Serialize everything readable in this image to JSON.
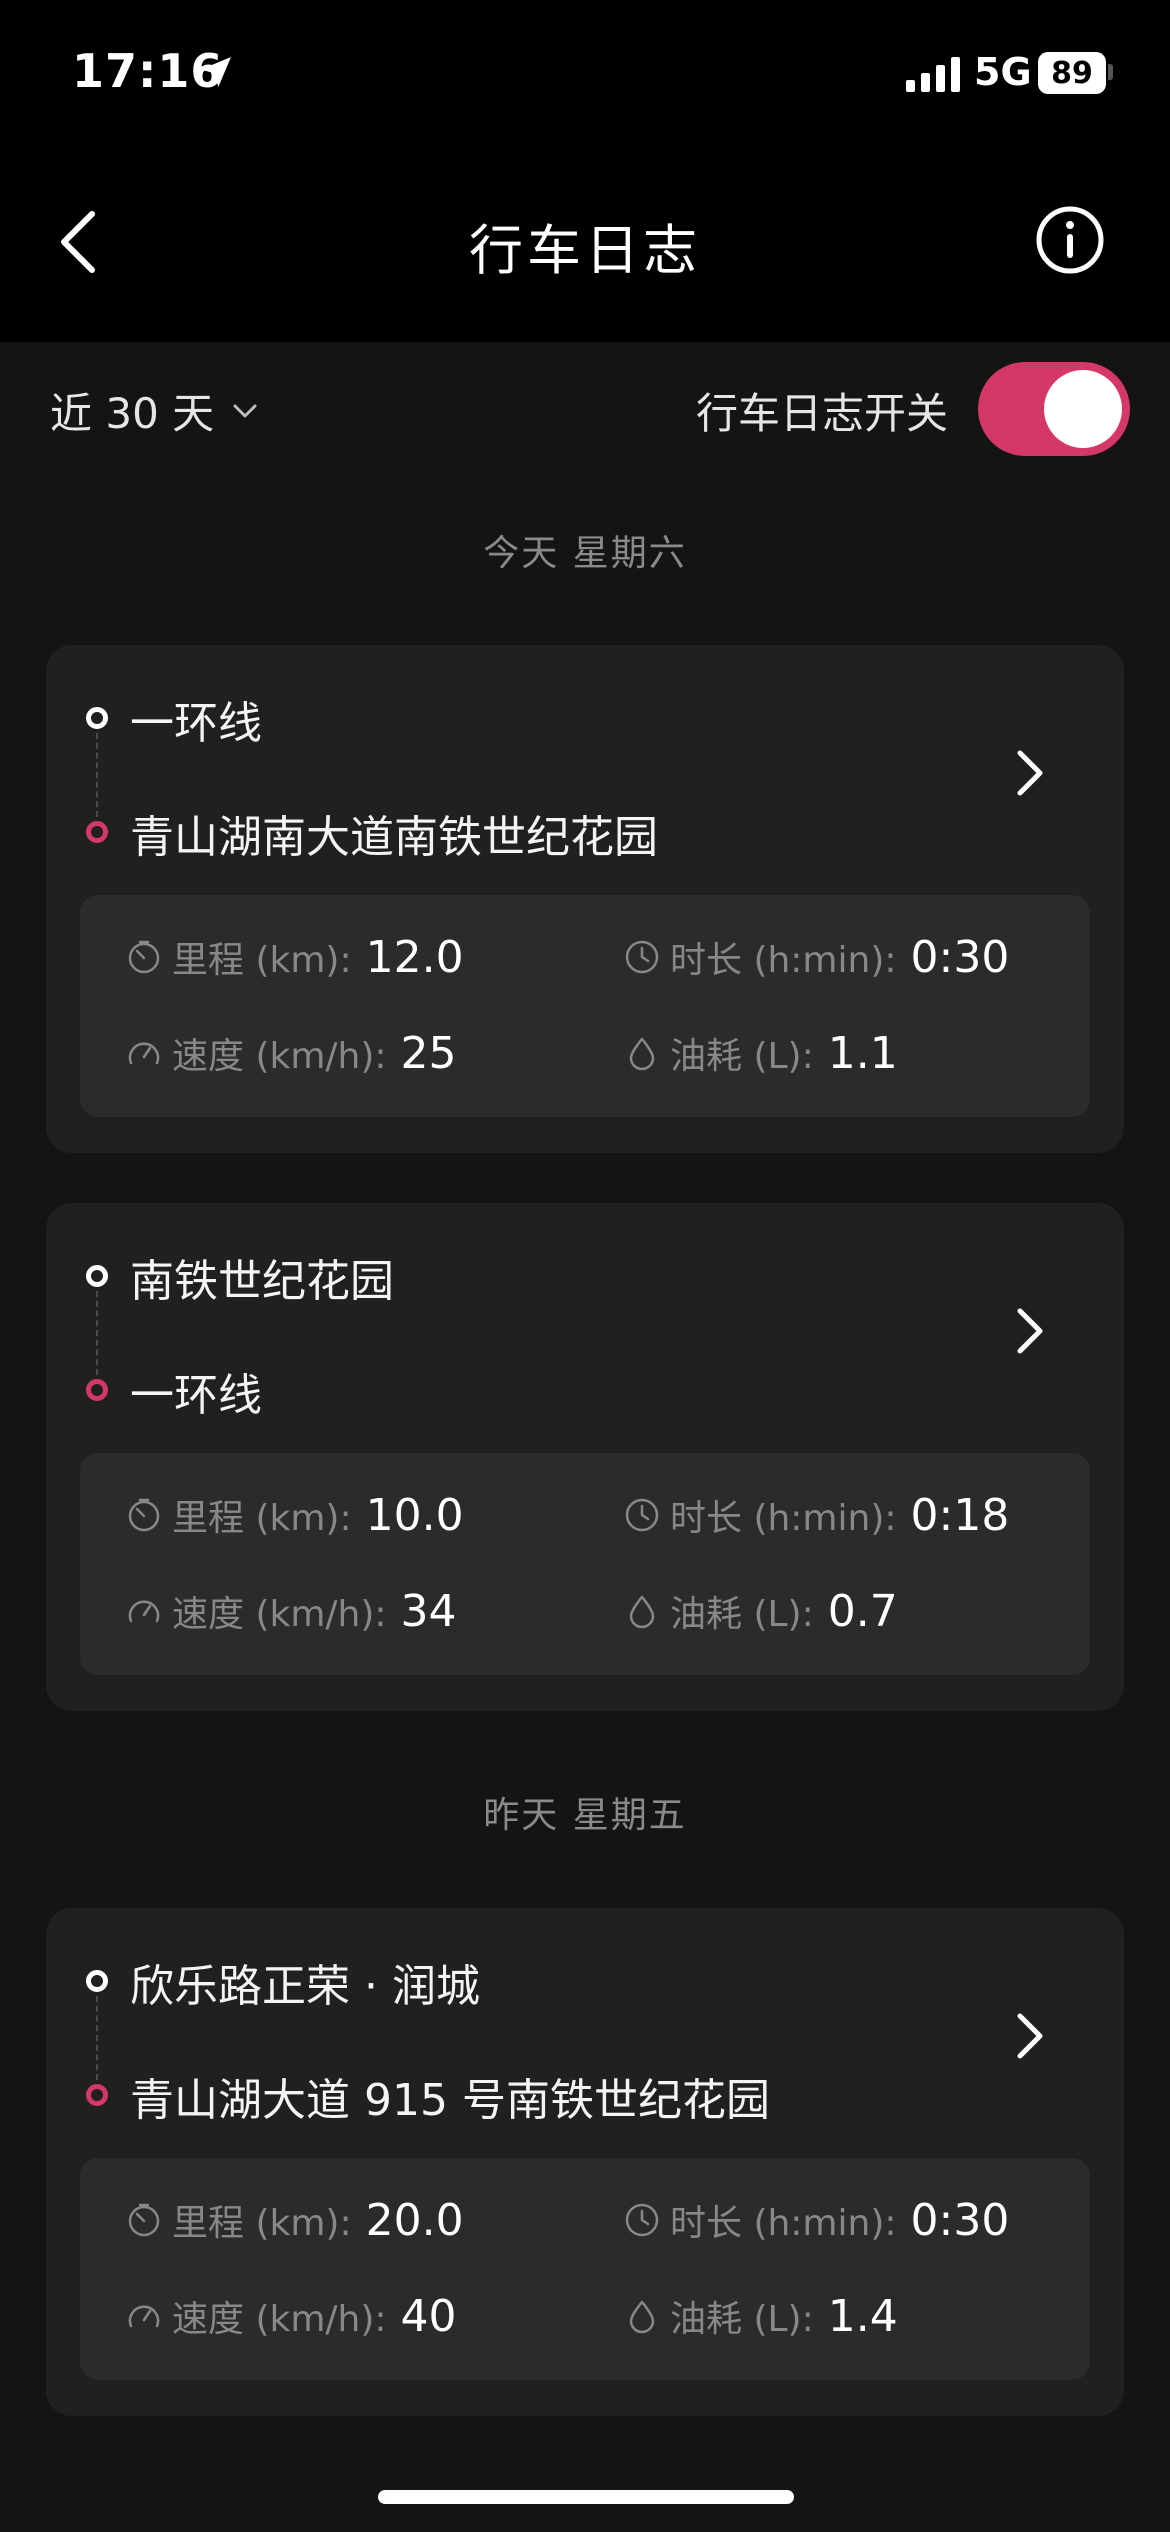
{
  "status_bar": {
    "time": "17:16",
    "network": "5G",
    "battery": "89"
  },
  "nav": {
    "title": "行车日志"
  },
  "filter": {
    "range": "近 30 天",
    "toggle_label": "行车日志开关",
    "toggle_on": true,
    "accent_color": "#d43866"
  },
  "days": [
    {
      "header": "今天  星期六",
      "trips": [
        {
          "start": "一环线",
          "end": "青山湖南大道南铁世纪花园",
          "distance_label": "里程 (km):",
          "distance": "12.0",
          "duration_label": "时长 (h:min):",
          "duration": "0:30",
          "speed_label": "速度 (km/h):",
          "speed": "25",
          "fuel_label": "油耗 (L):",
          "fuel": "1.1"
        },
        {
          "start": "南铁世纪花园",
          "end": "一环线",
          "distance_label": "里程 (km):",
          "distance": "10.0",
          "duration_label": "时长 (h:min):",
          "duration": "0:18",
          "speed_label": "速度 (km/h):",
          "speed": "34",
          "fuel_label": "油耗 (L):",
          "fuel": "0.7"
        }
      ]
    },
    {
      "header": "昨天  星期五",
      "trips": [
        {
          "start": "欣乐路正荣 · 润城",
          "end": "青山湖大道 915 号南铁世纪花园",
          "distance_label": "里程 (km):",
          "distance": "20.0",
          "duration_label": "时长 (h:min):",
          "duration": "0:30",
          "speed_label": "速度 (km/h):",
          "speed": "40",
          "fuel_label": "油耗 (L):",
          "fuel": "1.4"
        }
      ]
    }
  ]
}
